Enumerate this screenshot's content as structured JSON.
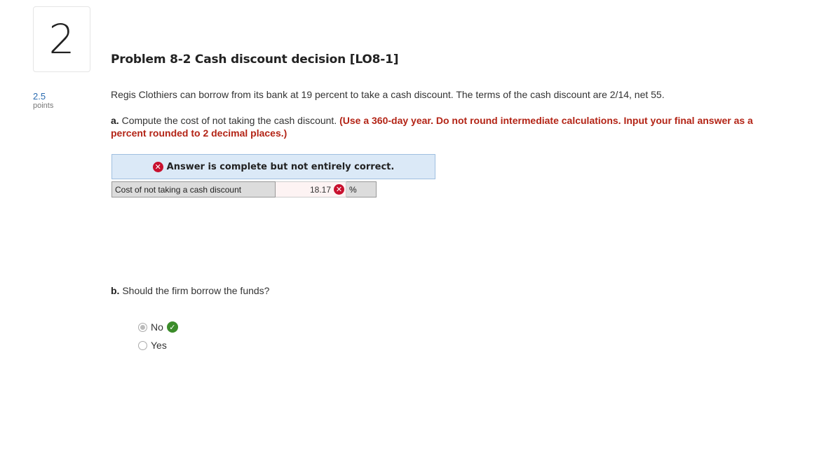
{
  "question": {
    "number": "2",
    "title": "Problem 8-2 Cash discount decision [LO8-1]",
    "points_value": "2.5",
    "points_label": "points",
    "stem": "Regis Clothiers can borrow from its bank at 19 percent to take a cash discount. The terms of the cash discount are 2/14, net 55."
  },
  "part_a": {
    "label": "a.",
    "prompt": "Compute the cost of not taking the cash discount.",
    "instructions": "(Use a 360-day year. Do not round intermediate calculations. Input your final answer as a percent rounded to 2 decimal places.)",
    "feedback": "Answer is complete but not entirely correct.",
    "answer_label": "Cost of not taking a cash discount",
    "answer_value": "18.17",
    "answer_unit": "%",
    "status_icon": "x-circle-icon",
    "status_color": "#c8102e"
  },
  "part_b": {
    "label": "b.",
    "prompt": "Should the firm borrow the funds?",
    "options": [
      {
        "label": "No",
        "selected": true,
        "correct": true
      },
      {
        "label": "Yes",
        "selected": false
      }
    ],
    "correct_color": "#3b8c2a"
  }
}
